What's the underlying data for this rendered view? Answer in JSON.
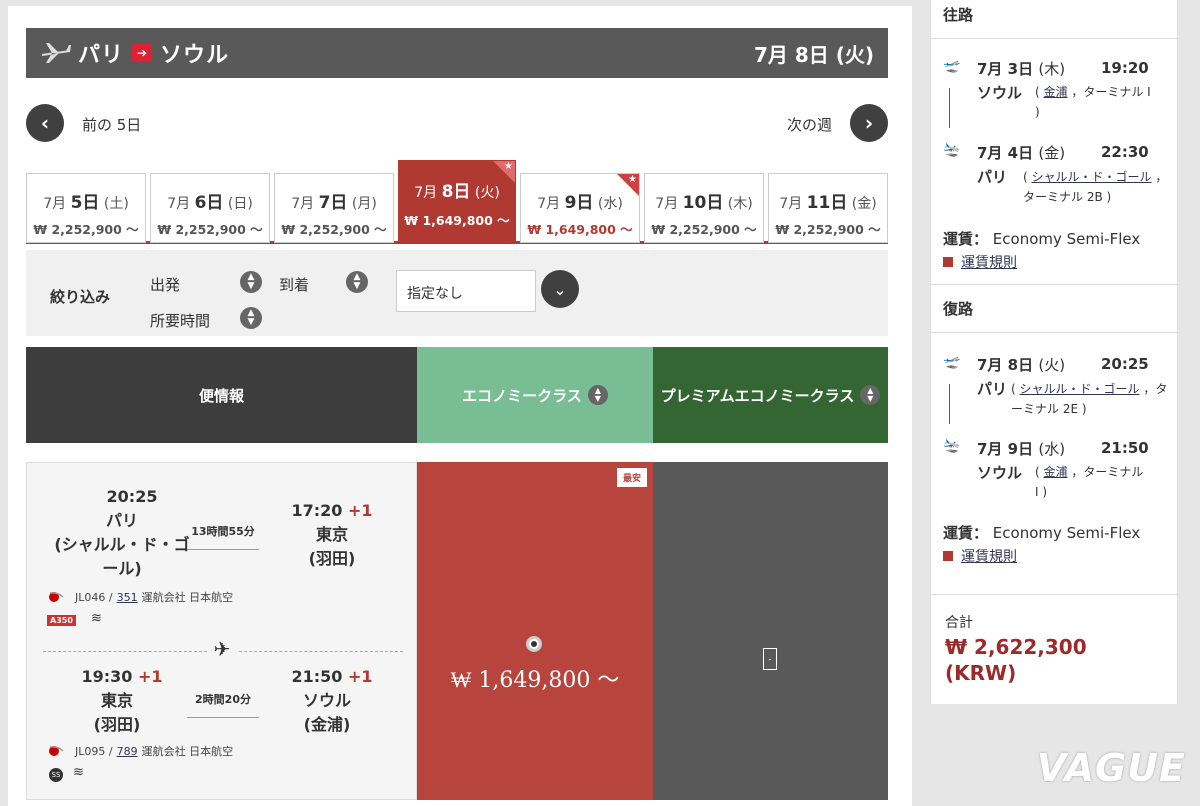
{
  "header": {
    "origin": "パリ",
    "destination": "ソウル",
    "date": "7月 8日 (火)"
  },
  "nav": {
    "prev": "前の 5日",
    "next": "次の週"
  },
  "date_tabs": [
    {
      "month": "7月",
      "day": "5日",
      "dow": "(土)",
      "price": "₩ 2,252,900 ～"
    },
    {
      "month": "7月",
      "day": "6日",
      "dow": "(日)",
      "price": "₩ 2,252,900 ～"
    },
    {
      "month": "7月",
      "day": "7日",
      "dow": "(月)",
      "price": "₩ 2,252,900 ～"
    },
    {
      "month": "7月",
      "day": "8日",
      "dow": "(火)",
      "price": "₩ 1,649,800 ～"
    },
    {
      "month": "7月",
      "day": "9日",
      "dow": "(水)",
      "price": "₩ 1,649,800 ～"
    },
    {
      "month": "7月",
      "day": "10日",
      "dow": "(木)",
      "price": "₩ 2,252,900 ～"
    },
    {
      "month": "7月",
      "day": "11日",
      "dow": "(金)",
      "price": "₩ 2,252,900 ～"
    }
  ],
  "filter": {
    "title": "絞り込み",
    "departure": "出発",
    "arrival": "到着",
    "duration": "所要時間",
    "select": "指定なし"
  },
  "table": {
    "info": "便情報",
    "economy": "エコノミークラス",
    "premium": "プレミアムエコノミークラス"
  },
  "result": {
    "seg1": {
      "dep_time": "20:25",
      "dep_city": "パリ\n(シャルル・ド・ゴ\nール)",
      "arr_time": "17:20",
      "arr_plus": "+1",
      "arr_city": "東京\n(羽田)",
      "duration": "13時間55分",
      "flight": "JL046 /",
      "aircraft": "351",
      "operator": "運航会社 日本航空",
      "badge": "A350"
    },
    "seg2": {
      "dep_time": "19:30",
      "dep_plus": "+1",
      "dep_city": "東京\n(羽田)",
      "arr_time": "21:50",
      "arr_plus": "+1",
      "arr_city": "ソウル\n(金浦)",
      "duration": "2時間20分",
      "flight": "JL095 /",
      "aircraft": "789",
      "operator": "運航会社 日本航空",
      "badge": "SS"
    },
    "eco_badge": "最安",
    "eco_price": "₩ 1,649,800 ～"
  },
  "summary": {
    "outbound_title": "往路",
    "out_leg1": {
      "date": "7月 3日",
      "dow": "(木)",
      "time": "19:20",
      "city": "ソウル",
      "airport": "金浦",
      "terminal": "，ターミナル I\n)"
    },
    "out_leg2": {
      "date": "7月 4日",
      "dow": "(金)",
      "time": "22:30",
      "city": "パリ",
      "airport": "シャルル・ド・ゴール",
      "terminal": "，ターミナル 2B )"
    },
    "out_fare_label": "運賃：",
    "out_fare": "Economy Semi-Flex",
    "out_rule": "運賃規則",
    "return_title": "復路",
    "ret_leg1": {
      "date": "7月 8日",
      "dow": "(火)",
      "time": "20:25",
      "city": "パリ",
      "airport": "シャルル・ド・ゴール",
      "terminal": "，ターミナル 2E )"
    },
    "ret_leg2": {
      "date": "7月 9日",
      "dow": "(水)",
      "time": "21:50",
      "city": "ソウル",
      "airport": "金浦",
      "terminal": "，ターミナル\nI )"
    },
    "ret_fare_label": "運賃：",
    "ret_fare": "Economy Semi-Flex",
    "ret_rule": "運賃規則",
    "total_label": "合計",
    "total_value": "₩ 2,622,300\n(KRW)"
  },
  "watermark": "VAGUE",
  "colors": {
    "accent": "#b03a32",
    "economy": "#78bd94",
    "premium": "#336633",
    "header": "#595959"
  }
}
